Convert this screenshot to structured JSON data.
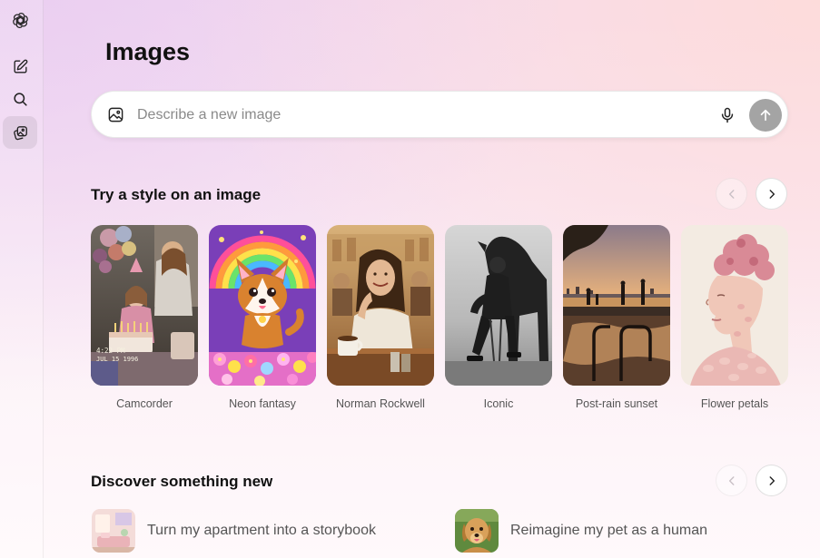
{
  "page": {
    "title": "Images"
  },
  "sidebar": {
    "items": [
      {
        "icon": "openai-logo-icon"
      },
      {
        "icon": "new-chat-icon"
      },
      {
        "icon": "search-icon"
      },
      {
        "icon": "images-library-icon",
        "active": true
      }
    ]
  },
  "prompt": {
    "placeholder": "Describe a new image",
    "value": "",
    "left_icon": "image-upload-icon",
    "mic_icon": "microphone-icon",
    "send_icon": "arrow-up-icon"
  },
  "styles_section": {
    "title": "Try a style on an image",
    "items": [
      {
        "label": "Camcorder",
        "caption": "4:22 PM\nJUL 15 1996"
      },
      {
        "label": "Neon fantasy"
      },
      {
        "label": "Norman Rockwell"
      },
      {
        "label": "Iconic"
      },
      {
        "label": "Post-rain sunset"
      },
      {
        "label": "Flower petals"
      }
    ],
    "prev_enabled": false,
    "next_enabled": true
  },
  "discover_section": {
    "title": "Discover something new",
    "items": [
      {
        "label": "Turn my apartment into a storybook"
      },
      {
        "label": "Reimagine my pet as a human"
      }
    ],
    "prev_enabled": false,
    "next_enabled": true
  },
  "colors": {
    "send_button": "#a4a4a4",
    "background_top": "#f4dcf2",
    "background_bottom": "#fff9fb"
  }
}
